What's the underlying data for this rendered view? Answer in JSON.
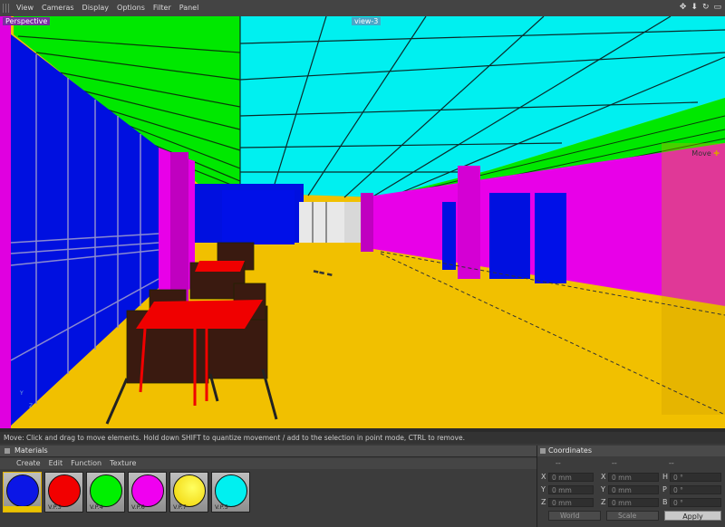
{
  "menubar": {
    "items": [
      "View",
      "Cameras",
      "Display",
      "Options",
      "Filter",
      "Panel"
    ]
  },
  "viewport": {
    "label": "Perspective",
    "title": "view-3",
    "tool": "Move"
  },
  "status": {
    "text": "Move: Click and drag to move elements. Hold down SHIFT to quantize movement / add to the selection in point mode, CTRL to remove."
  },
  "materials": {
    "title": "Materials",
    "tabs": [
      "Create",
      "Edit",
      "Function",
      "Texture"
    ],
    "swatches": [
      {
        "label": "",
        "color": "#0b16e6"
      },
      {
        "label": "V.P.3",
        "color": "#f20000"
      },
      {
        "label": "V.P.4",
        "color": "#00f000"
      },
      {
        "label": "V.P.6",
        "color": "#f000f0"
      },
      {
        "label": "V.P.7",
        "color": "#f0f000"
      },
      {
        "label": "V.P.5",
        "color": "#00f0f0"
      }
    ]
  },
  "coordinates": {
    "title": "Coordinates",
    "columns": [
      "--",
      "--",
      "--"
    ],
    "rows": [
      {
        "a1": "X",
        "v1": "0 mm",
        "a2": "X",
        "v2": "0 mm",
        "a3": "H",
        "v3": "0 °"
      },
      {
        "a1": "Y",
        "v1": "0 mm",
        "a2": "Y",
        "v2": "0 mm",
        "a3": "P",
        "v3": "0 °"
      },
      {
        "a1": "Z",
        "v1": "0 mm",
        "a2": "Z",
        "v2": "0 mm",
        "a3": "B",
        "v3": "0 °"
      }
    ],
    "space": "World",
    "mode": "Scale",
    "apply_label": "Apply"
  }
}
